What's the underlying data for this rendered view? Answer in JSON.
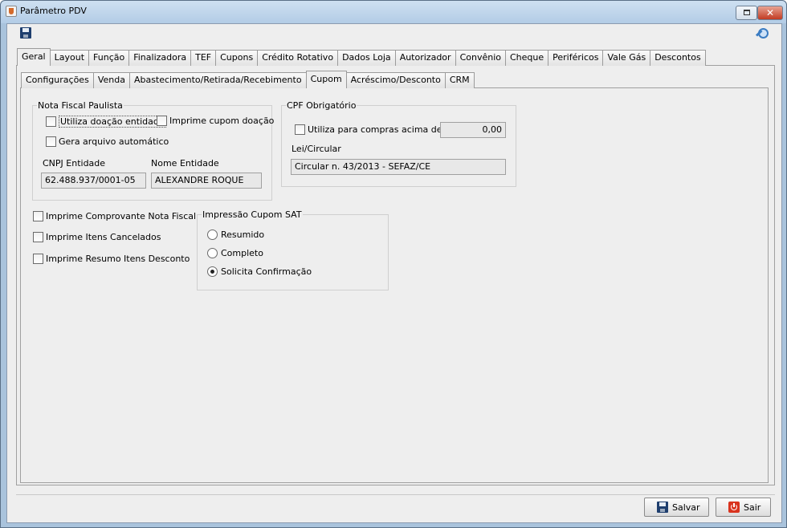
{
  "window": {
    "title": "Parâmetro PDV"
  },
  "toolbar": {
    "save_icon": "save-icon",
    "key_icon": "key-icon"
  },
  "main_tabs": [
    "Geral",
    "Layout",
    "Função",
    "Finalizadora",
    "TEF",
    "Cupons",
    "Crédito Rotativo",
    "Dados Loja",
    "Autorizador",
    "Convênio",
    "Cheque",
    "Periféricos",
    "Vale Gás",
    "Descontos"
  ],
  "main_tab_active": "Geral",
  "sub_tabs": [
    "Configurações",
    "Venda",
    "Abastecimento/Retirada/Recebimento",
    "Cupom",
    "Acréscimo/Desconto",
    "CRM"
  ],
  "sub_tab_active": "Cupom",
  "nota_fiscal_paulista": {
    "title": "Nota Fiscal Paulista",
    "utiliza_doacao": {
      "label": "Utiliza doação entidade",
      "checked": false
    },
    "imprime_cupom_doacao": {
      "label": "Imprime cupom doação",
      "checked": false
    },
    "gera_arquivo": {
      "label": "Gera arquivo automático",
      "checked": false
    },
    "cnpj_label": "CNPJ Entidade",
    "cnpj_value": "62.488.937/0001-05",
    "nome_label": "Nome Entidade",
    "nome_value": "ALEXANDRE ROQUE"
  },
  "cpf_obrigatorio": {
    "title": "CPF Obrigatório",
    "utiliza_compras": {
      "label": "Utiliza para compras acima de R$",
      "checked": false
    },
    "valor": "0,00",
    "lei_label": "Lei/Circular",
    "lei_value": "Circular n. 43/2013 - SEFAZ/CE"
  },
  "standalone_checks": [
    {
      "label": "Imprime Comprovante Nota Fiscal",
      "checked": false
    },
    {
      "label": "Imprime Itens Cancelados",
      "checked": false
    },
    {
      "label": "Imprime Resumo Itens Desconto",
      "checked": false
    }
  ],
  "impressao_cupom_sat": {
    "title": "Impressão Cupom SAT",
    "options": [
      "Resumido",
      "Completo",
      "Solicita Confirmação"
    ],
    "selected": "Solicita Confirmação"
  },
  "buttons": {
    "salvar": "Salvar",
    "sair": "Sair"
  }
}
